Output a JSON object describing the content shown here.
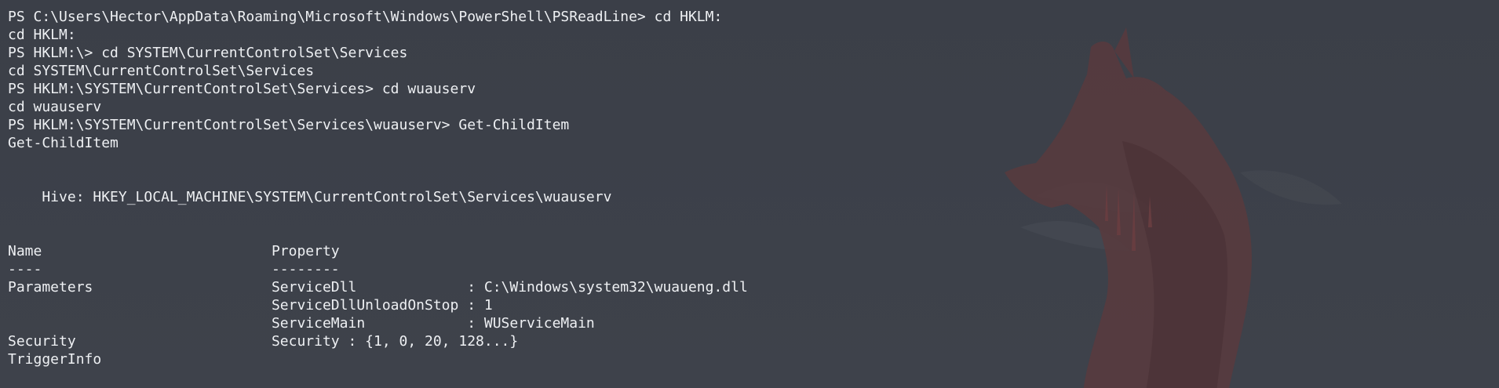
{
  "terminal": {
    "lines": [
      "PS C:\\Users\\Hector\\AppData\\Roaming\\Microsoft\\Windows\\PowerShell\\PSReadLine> cd HKLM:",
      "cd HKLM:",
      "PS HKLM:\\> cd SYSTEM\\CurrentControlSet\\Services",
      "cd SYSTEM\\CurrentControlSet\\Services",
      "PS HKLM:\\SYSTEM\\CurrentControlSet\\Services> cd wuauserv",
      "cd wuauserv",
      "PS HKLM:\\SYSTEM\\CurrentControlSet\\Services\\wuauserv> Get-ChildItem",
      "Get-ChildItem",
      "",
      "",
      "    Hive: HKEY_LOCAL_MACHINE\\SYSTEM\\CurrentControlSet\\Services\\wuauserv",
      "",
      "",
      "Name                           Property",
      "----                           --------",
      "Parameters                     ServiceDll             : C:\\Windows\\system32\\wuaueng.dll",
      "                               ServiceDllUnloadOnStop : 1",
      "                               ServiceMain            : WUServiceMain",
      "Security                       Security : {1, 0, 20, 128...}",
      "TriggerInfo"
    ]
  },
  "colors": {
    "background": "#3b3f48",
    "text": "#eef0f3",
    "wallpaper_fox": "#5a3a3d"
  },
  "icons": {
    "wallpaper": "fox-silhouette-icon"
  }
}
